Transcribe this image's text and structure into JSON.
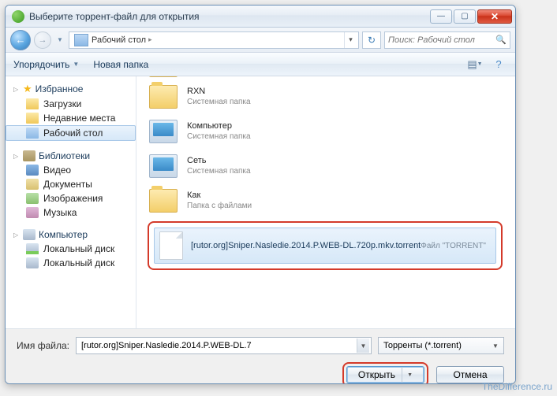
{
  "titlebar": {
    "title": "Выберите торрент-файл для открытия"
  },
  "nav": {
    "breadcrumb": "Рабочий стол",
    "search_placeholder": "Поиск: Рабочий стол"
  },
  "toolbar": {
    "organize": "Упорядочить",
    "new_folder": "Новая папка"
  },
  "sidebar": {
    "fav_head": "Избранное",
    "fav": [
      "Загрузки",
      "Недавние места",
      "Рабочий стол"
    ],
    "lib_head": "Библиотеки",
    "lib": [
      "Видео",
      "Документы",
      "Изображения",
      "Музыка"
    ],
    "comp_head": "Компьютер",
    "comp": [
      "Локальный диск",
      "Локальный диск"
    ]
  },
  "files": {
    "truncated_sub": "Системная папка",
    "items": [
      {
        "name": "RXN",
        "sub": "Системная папка",
        "icon": "folder"
      },
      {
        "name": "Компьютер",
        "sub": "Системная папка",
        "icon": "computer"
      },
      {
        "name": "Сеть",
        "sub": "Системная папка",
        "icon": "computer"
      },
      {
        "name": "Как",
        "sub": "Папка с файлами",
        "icon": "folder"
      }
    ],
    "selected": {
      "name": "[rutor.org]Sniper.Nasledie.2014.P.WEB-DL.720p.mkv.torrent",
      "sub": "Файл \"TORRENT\""
    }
  },
  "bottom": {
    "label": "Имя файла:",
    "value": "[rutor.org]Sniper.Nasledie.2014.P.WEB-DL.7",
    "filter": "Торренты (*.torrent)",
    "open": "Открыть",
    "cancel": "Отмена"
  },
  "watermark": "TheDifference.ru"
}
